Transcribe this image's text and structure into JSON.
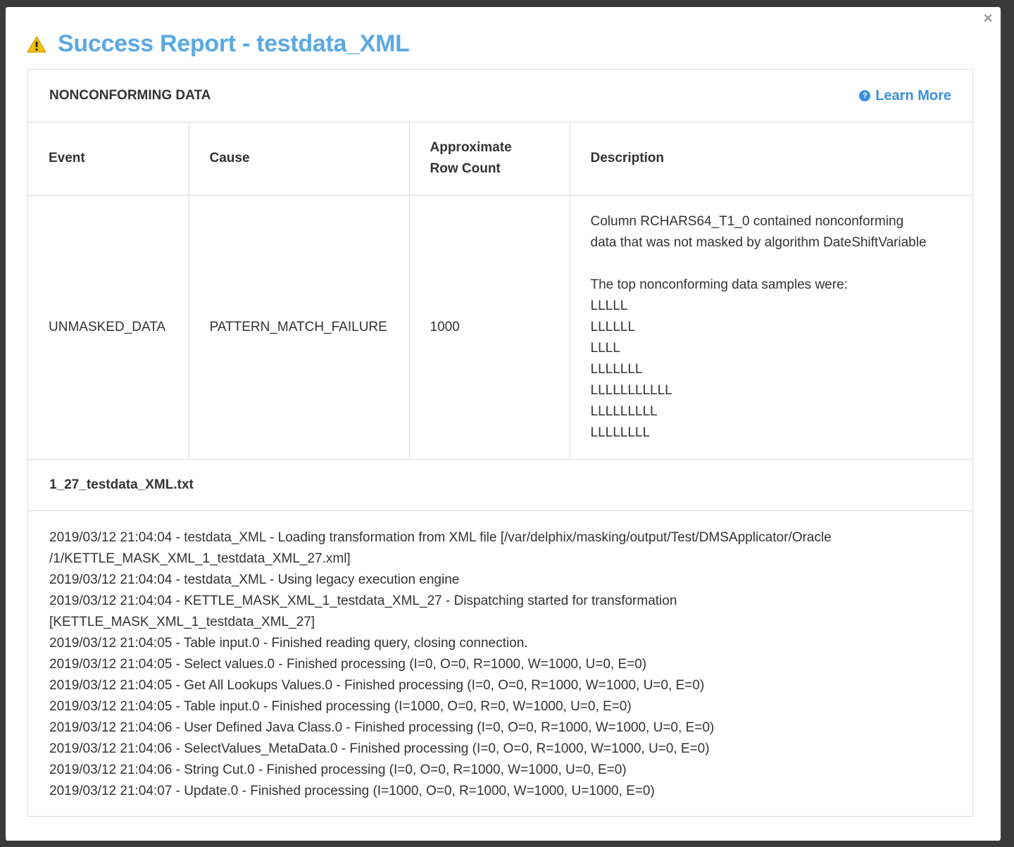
{
  "modal": {
    "title": "Success Report - testdata_XML",
    "close_label": "×"
  },
  "nonconforming": {
    "header": "NONCONFORMING DATA",
    "learn_more": "Learn More",
    "columns": [
      "Event",
      "Cause",
      "Approximate Row Count",
      "Description"
    ],
    "rows": [
      {
        "event": "UNMASKED_DATA",
        "cause": "PATTERN_MATCH_FAILURE",
        "row_count": "1000",
        "description_lines": [
          "Column RCHARS64_T1_0 contained nonconforming",
          "data that was not masked by algorithm DateShiftVariable",
          "",
          "The top nonconforming data samples were:",
          "LLLLL",
          "LLLLLL",
          "LLLL",
          "LLLLLLL",
          "LLLLLLLLLLL",
          "LLLLLLLLL",
          "LLLLLLLL"
        ]
      }
    ]
  },
  "log_file": {
    "name": "1_27_testdata_XML.txt",
    "lines": [
      "2019/03/12 21:04:04 - testdata_XML - Loading transformation from XML file [/var/delphix/masking/output/Test/DMSApplicator/Oracle",
      "/1/KETTLE_MASK_XML_1_testdata_XML_27.xml]",
      "2019/03/12 21:04:04 - testdata_XML - Using legacy execution engine",
      "2019/03/12 21:04:04 - KETTLE_MASK_XML_1_testdata_XML_27 - Dispatching started for transformation",
      "[KETTLE_MASK_XML_1_testdata_XML_27]",
      "2019/03/12 21:04:05 - Table input.0 - Finished reading query, closing connection.",
      "2019/03/12 21:04:05 - Select values.0 - Finished processing (I=0, O=0, R=1000, W=1000, U=0, E=0)",
      "2019/03/12 21:04:05 - Get All Lookups Values.0 - Finished processing (I=0, O=0, R=1000, W=1000, U=0, E=0)",
      "2019/03/12 21:04:05 - Table input.0 - Finished processing (I=1000, O=0, R=0, W=1000, U=0, E=0)",
      "2019/03/12 21:04:06 - User Defined Java Class.0 - Finished processing (I=0, O=0, R=1000, W=1000, U=0, E=0)",
      "2019/03/12 21:04:06 - SelectValues_MetaData.0 - Finished processing (I=0, O=0, R=1000, W=1000, U=0, E=0)",
      "2019/03/12 21:04:06 - String Cut.0 - Finished processing (I=0, O=0, R=1000, W=1000, U=0, E=0)",
      "2019/03/12 21:04:07 - Update.0 - Finished processing (I=1000, O=0, R=1000, W=1000, U=1000, E=0)"
    ]
  },
  "colors": {
    "title": "#5aa9e6",
    "link": "#3b8fe0",
    "warning": "#f2c200",
    "border": "#dddddd"
  }
}
